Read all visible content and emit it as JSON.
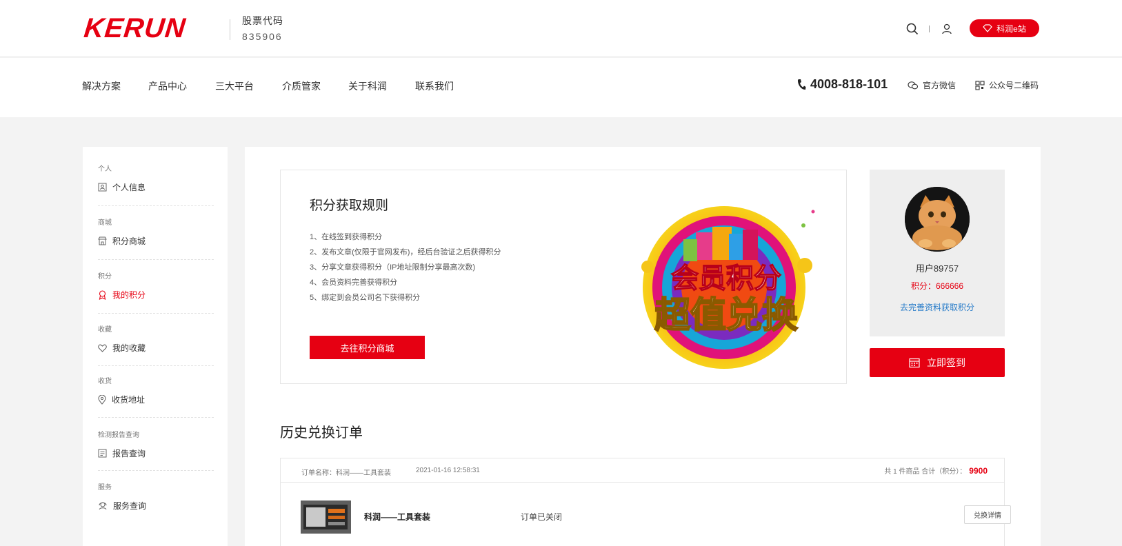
{
  "header": {
    "logo": "KERUN",
    "stock_label": "股票代码",
    "stock_code": "835906",
    "eshop_label": "科润e站"
  },
  "nav": {
    "items": [
      "解决方案",
      "产品中心",
      "三大平台",
      "介质管家",
      "关于科润",
      "联系我们"
    ],
    "phone": "4008-818-101",
    "wechat": "官方微信",
    "qrcode": "公众号二维码"
  },
  "sidebar": {
    "groups": [
      {
        "category": "个人",
        "item": "个人信息",
        "icon": "id-card-icon"
      },
      {
        "category": "商城",
        "item": "积分商城",
        "icon": "shop-icon"
      },
      {
        "category": "积分",
        "item": "我的积分",
        "icon": "medal-icon",
        "active": true
      },
      {
        "category": "收藏",
        "item": "我的收藏",
        "icon": "heart-icon"
      },
      {
        "category": "收货",
        "item": "收货地址",
        "icon": "location-icon"
      },
      {
        "category": "检测报告查询",
        "item": "报告查询",
        "icon": "report-icon"
      },
      {
        "category": "服务",
        "item": "服务查询",
        "icon": "service-icon"
      }
    ]
  },
  "rules": {
    "title": "积分获取规则",
    "items": [
      "1、在线签到获得积分",
      "2、发布文章(仅限于官网发布)，经后台验证之后获得积分",
      "3、分享文章获得积分（IP地址限制分享最高次数)",
      "4、会员资料完善获得积分",
      "5、绑定到会员公司名下获得积分"
    ],
    "button": "去往积分商城",
    "promo_line1": "会员积分",
    "promo_line2": "超值兑换"
  },
  "user": {
    "name": "用户89757",
    "points": "积分：666666",
    "complete_link": "去完善资料获取积分",
    "signin_button": "立即签到"
  },
  "history": {
    "title": "历史兑换订单",
    "order": {
      "name": "订单名称：科润——工具套装",
      "time": "2021-01-16  12:58:31",
      "total_label": "共 1 件商品  合计（积分）：",
      "total_value": "9900",
      "product": "科润——工具套装",
      "status": "订单已关闭",
      "detail_button": "兑换详情"
    }
  },
  "colors": {
    "brand": "#e60012",
    "link": "#2a7dc9"
  }
}
